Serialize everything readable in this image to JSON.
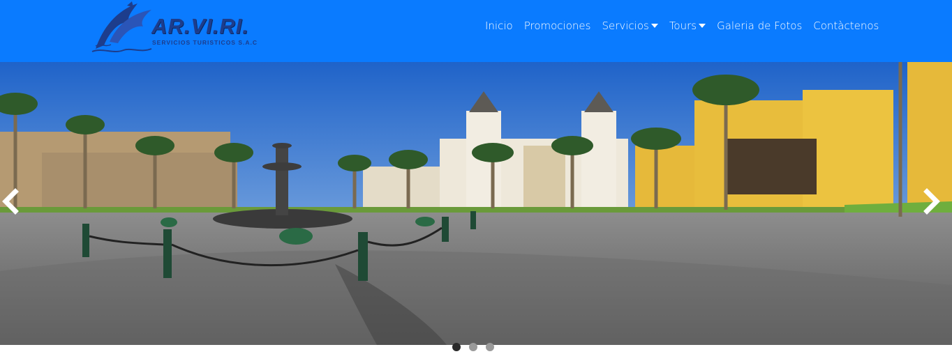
{
  "brand": {
    "name": "AR.VI.RI.",
    "subtitle": "SERVICIOS TURISTICOS S.A.C",
    "logo_icon": "dolphins-logo"
  },
  "nav": {
    "items": [
      {
        "label": "Inicio",
        "dropdown": false
      },
      {
        "label": "Promociones",
        "dropdown": false
      },
      {
        "label": "Servicios",
        "dropdown": true
      },
      {
        "label": "Tours",
        "dropdown": true
      },
      {
        "label": "Galeria de Fotos",
        "dropdown": false
      },
      {
        "label": "Contàctenos",
        "dropdown": false
      }
    ]
  },
  "carousel": {
    "prev_icon": "chevron-left-icon",
    "next_icon": "chevron-right-icon",
    "slide_count": 3,
    "active_index": 0
  },
  "colors": {
    "navbar": "#0a7bff",
    "brand_text": "#1d3d8c",
    "menu_text": "#ffffff"
  }
}
